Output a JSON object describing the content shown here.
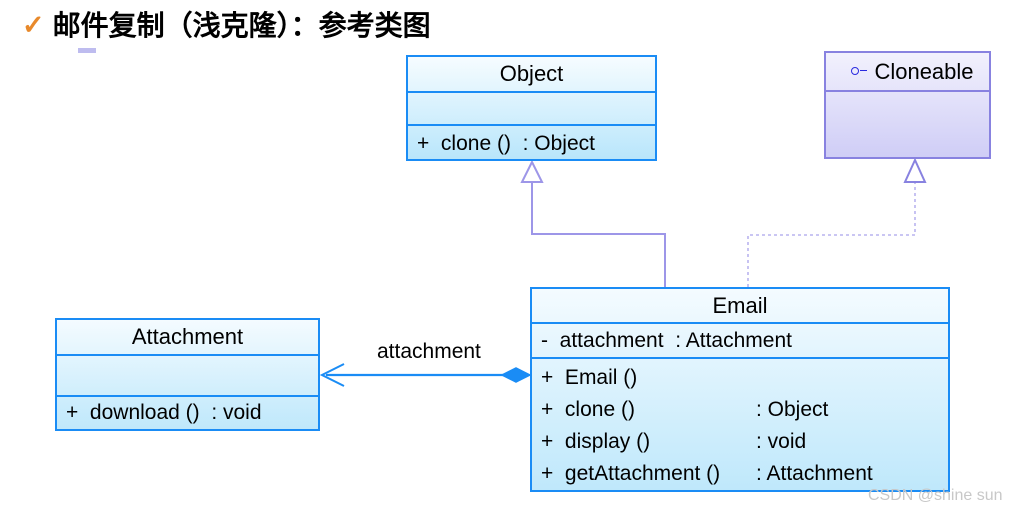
{
  "title": {
    "check_icon": "✓",
    "text": "邮件复制（浅克隆）：参考类图"
  },
  "colors": {
    "class_border": "#1a8cf5",
    "class_fill_top": "#f4fbff",
    "class_fill_bottom": "#bfe8fb",
    "interface_border": "#8882e0",
    "interface_fill_top": "#f2f1fd",
    "interface_fill_bottom": "#cfcdf6",
    "inheritance_line": "#9d96e8",
    "association_line": "#1a8cf5",
    "title_check": "#E8892B",
    "watermark": "#c8c8c8"
  },
  "diagram": {
    "type": "uml-class-diagram",
    "classes": [
      {
        "id": "object",
        "name": "Object",
        "stereotype_icon": "",
        "attributes": [],
        "methods": [
          {
            "visibility": "+",
            "signature": "clone ()",
            "return_type": "Object",
            "text": "+  clone ()  : Object"
          }
        ]
      },
      {
        "id": "cloneable",
        "name": "Cloneable",
        "stereotype_icon": "interface-lollipop-icon",
        "attributes": [],
        "methods": []
      },
      {
        "id": "email",
        "name": "Email",
        "stereotype_icon": "",
        "attributes": [
          {
            "visibility": "-",
            "text": "-  attachment  : Attachment"
          }
        ],
        "methods": [
          {
            "visibility": "+",
            "name_part": "+  Email ()",
            "type_part": ""
          },
          {
            "visibility": "+",
            "name_part": "+  clone ()",
            "type_part": ": Object"
          },
          {
            "visibility": "+",
            "name_part": "+  display ()",
            "type_part": ": void"
          },
          {
            "visibility": "+",
            "name_part": "+  getAttachment ()",
            "type_part": ": Attachment"
          }
        ]
      },
      {
        "id": "attachment",
        "name": "Attachment",
        "stereotype_icon": "",
        "attributes": [],
        "methods": [
          {
            "visibility": "+",
            "signature": "download ()",
            "return_type": "void",
            "text": "+  download ()  : void"
          }
        ]
      }
    ],
    "relationships": [
      {
        "kind": "generalization",
        "from": "email",
        "to": "object",
        "style": "solid",
        "arrow": "hollow-triangle",
        "label": ""
      },
      {
        "kind": "realization",
        "from": "email",
        "to": "cloneable",
        "style": "dashed",
        "arrow": "hollow-triangle",
        "label": ""
      },
      {
        "kind": "composition",
        "from": "email",
        "to": "attachment",
        "style": "solid",
        "arrow": "open-arrow",
        "source_decoration": "filled-diamond",
        "label": "attachment"
      }
    ]
  },
  "watermark": "CSDN @shine sun"
}
